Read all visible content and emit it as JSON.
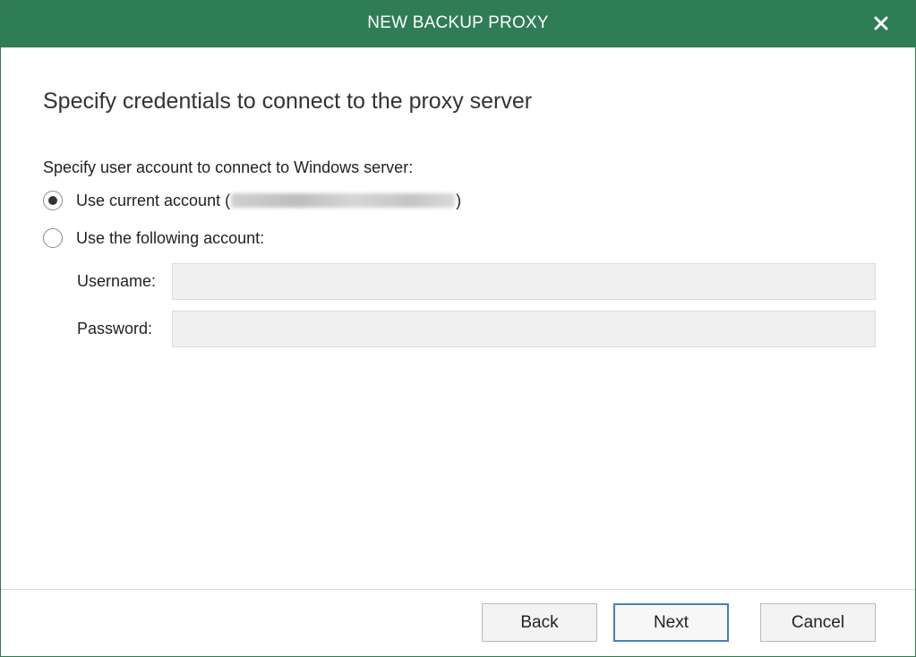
{
  "window": {
    "title": "NEW BACKUP PROXY",
    "close_icon": "close-icon"
  },
  "page": {
    "heading": "Specify credentials to connect to the proxy server"
  },
  "credentials": {
    "section_label": "Specify user account to connect to Windows server:",
    "options": [
      {
        "label_prefix": "Use current account (",
        "label_suffix": ")",
        "selected": true
      },
      {
        "label": "Use the following account:",
        "selected": false
      }
    ],
    "username_label": "Username:",
    "username_value": "",
    "password_label": "Password:",
    "password_value": ""
  },
  "footer": {
    "back_label": "Back",
    "next_label": "Next",
    "cancel_label": "Cancel"
  },
  "colors": {
    "titlebar": "#2e7d55",
    "field_background": "#f0f0f0",
    "default_button_border": "#4a7fb6"
  }
}
